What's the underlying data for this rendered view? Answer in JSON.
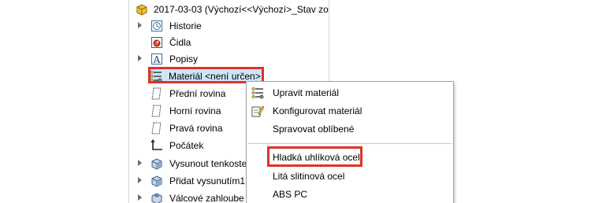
{
  "tree": {
    "root_label": "2017-03-03  (Výchozí<<Výchozí>_Stav zob",
    "items": [
      {
        "label": "Historie",
        "icon": "history-icon",
        "has_arrow": true
      },
      {
        "label": "Čidla",
        "icon": "sensor-icon",
        "has_arrow": false
      },
      {
        "label": "Popisy",
        "icon": "annotations-icon",
        "has_arrow": true
      },
      {
        "label": "Materiál <není určen>",
        "icon": "material-icon",
        "has_arrow": false
      },
      {
        "label": "Přední rovina",
        "icon": "plane-icon",
        "has_arrow": false
      },
      {
        "label": "Horní rovina",
        "icon": "plane-icon",
        "has_arrow": false
      },
      {
        "label": "Pravá rovina",
        "icon": "plane-icon",
        "has_arrow": false
      },
      {
        "label": "Počátek",
        "icon": "origin-icon",
        "has_arrow": false
      },
      {
        "label": "Vysunout tenkoste",
        "icon": "feature-icon",
        "has_arrow": true
      },
      {
        "label": "Přidat vysunutím1",
        "icon": "feature-icon",
        "has_arrow": true
      },
      {
        "label": "Válcové zahloube",
        "icon": "feature-icon",
        "has_arrow": true
      }
    ]
  },
  "context_menu": {
    "items": [
      {
        "label": "Upravit materiál",
        "icon": "edit-material-icon"
      },
      {
        "label": "Konfigurovat materiál",
        "icon": "configure-material-icon"
      },
      {
        "label": "Spravovat oblíbené",
        "icon": ""
      },
      {
        "label": "Hladká uhlíková ocel",
        "icon": ""
      },
      {
        "label": "Litá slitinová ocel",
        "icon": ""
      },
      {
        "label": "ABS PC",
        "icon": ""
      }
    ]
  },
  "colors": {
    "highlight_border": "#e0322b",
    "selection_fill": "#cde6f7"
  }
}
